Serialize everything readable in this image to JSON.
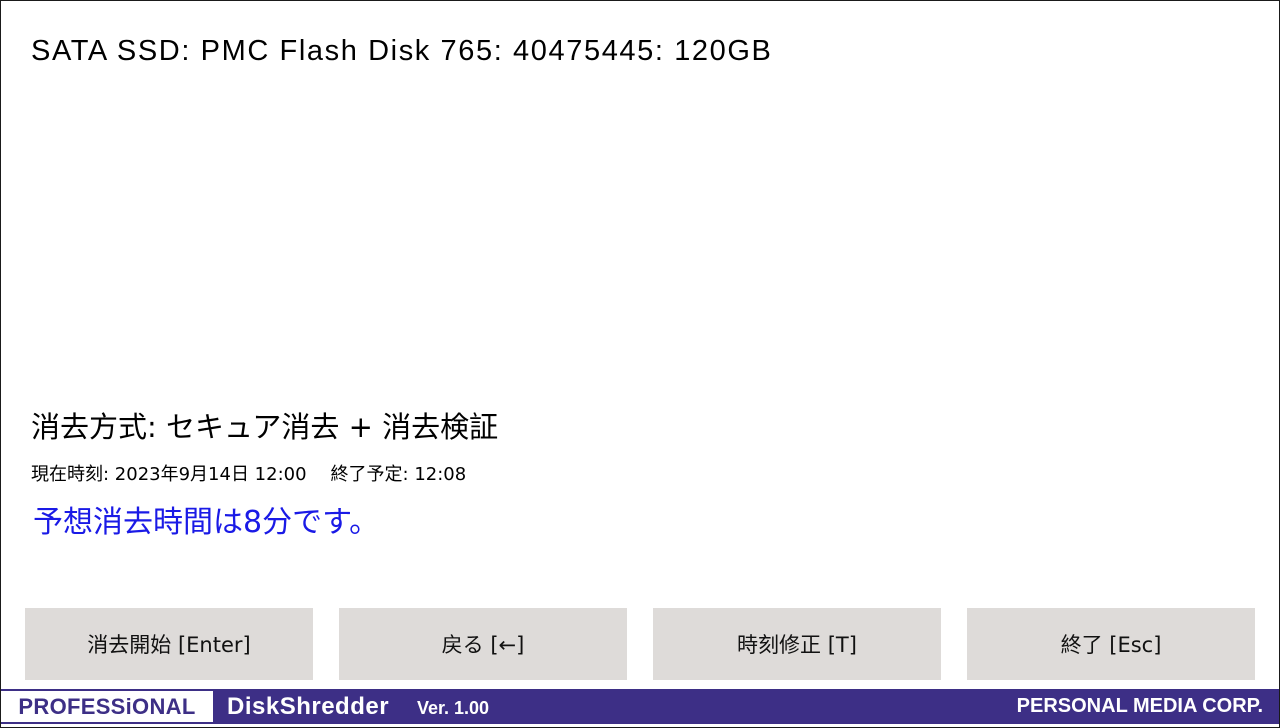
{
  "disk": {
    "title": "SATA SSD: PMC Flash Disk 765: 40475445: 120GB"
  },
  "erase": {
    "method_line": "消去方式: セキュア消去 + 消去検証",
    "current_time_text": "現在時刻: 2023年9月14日 12:00",
    "end_time_text": "終了予定: 12:08",
    "estimate_text": "予想消去時間は8分です。"
  },
  "buttons": {
    "start_label": "消去開始 [Enter]",
    "back_label": "戻る [←]",
    "time_label": "時刻修正 [T]",
    "exit_label": "終了 [Esc]"
  },
  "footer": {
    "edition": "PROFESSiONAL",
    "product": "DiskShredder",
    "version": "Ver. 1.00",
    "company": "PERSONAL MEDIA CORP."
  },
  "colors": {
    "accent_purple": "#3d2f86",
    "estimate_blue": "#1a1ae6",
    "button_gray": "#dedbd9"
  }
}
